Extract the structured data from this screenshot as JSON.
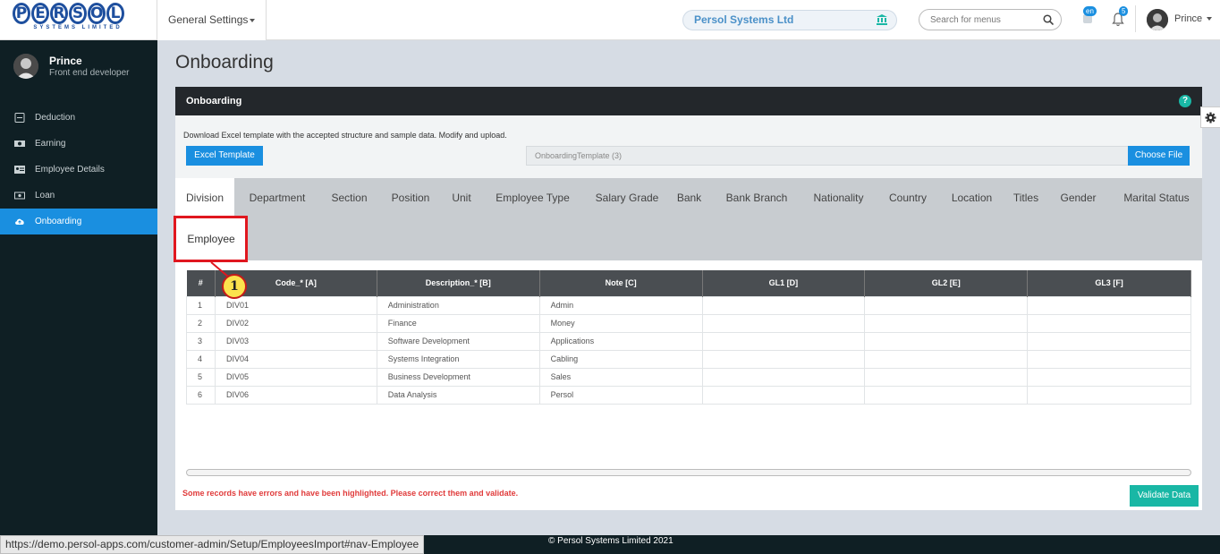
{
  "header": {
    "logo_letters": [
      "P",
      "E",
      "R",
      "S",
      "O",
      "L"
    ],
    "logo_sub": "SYSTEMS LIMITED",
    "general_settings": "General Settings",
    "company": "Persol Systems Ltd",
    "search_placeholder": "Search for menus",
    "lang_badge": "en",
    "notif_count": "5",
    "user_name": "Prince"
  },
  "sidebar": {
    "profile_name": "Prince",
    "profile_role": "Front end developer",
    "items": [
      {
        "label": "Deduction",
        "icon": "minus-square-icon"
      },
      {
        "label": "Earning",
        "icon": "money-icon"
      },
      {
        "label": "Employee Details",
        "icon": "id-card-icon"
      },
      {
        "label": "Loan",
        "icon": "cash-icon"
      },
      {
        "label": "Onboarding",
        "icon": "cloud-upload-icon",
        "active": true
      }
    ]
  },
  "page": {
    "title": "Onboarding",
    "panel_title": "Onboarding",
    "upload_text": "Download Excel template with the accepted structure and sample data. Modify and upload.",
    "excel_btn": "Excel Template",
    "file_name": "OnboardingTemplate (3)",
    "choose_btn": "Choose File",
    "tabs": [
      "Division",
      "Department",
      "Section",
      "Position",
      "Unit",
      "Employee Type",
      "Salary Grade",
      "Bank",
      "Bank Branch",
      "Nationality",
      "Country",
      "Location",
      "Titles",
      "Gender",
      "Marital Status"
    ],
    "tab_employee": "Employee",
    "callout_number": "1",
    "table": {
      "headers": [
        "#",
        "Code_* [A]",
        "Description_* [B]",
        "Note [C]",
        "GL1 [D]",
        "GL2 [E]",
        "GL3 [F]"
      ],
      "rows": [
        [
          "1",
          "DIV01",
          "Administration",
          "Admin",
          "",
          "",
          ""
        ],
        [
          "2",
          "DIV02",
          "Finance",
          "Money",
          "",
          "",
          ""
        ],
        [
          "3",
          "DIV03",
          "Software Development",
          "Applications",
          "",
          "",
          ""
        ],
        [
          "4",
          "DIV04",
          "Systems Integration",
          "Cabling",
          "",
          "",
          ""
        ],
        [
          "5",
          "DIV05",
          "Business Development",
          "Sales",
          "",
          "",
          ""
        ],
        [
          "6",
          "DIV06",
          "Data Analysis",
          "Persol",
          "",
          "",
          ""
        ]
      ]
    },
    "error_msg": "Some records have errors and have been highlighted. Please correct them and validate.",
    "validate_btn": "Validate Data"
  },
  "footer": {
    "copyright": "© Persol Systems Limited 2021",
    "status_url": "https://demo.persol-apps.com/customer-admin/Setup/EmployeesImport#nav-Employee"
  }
}
